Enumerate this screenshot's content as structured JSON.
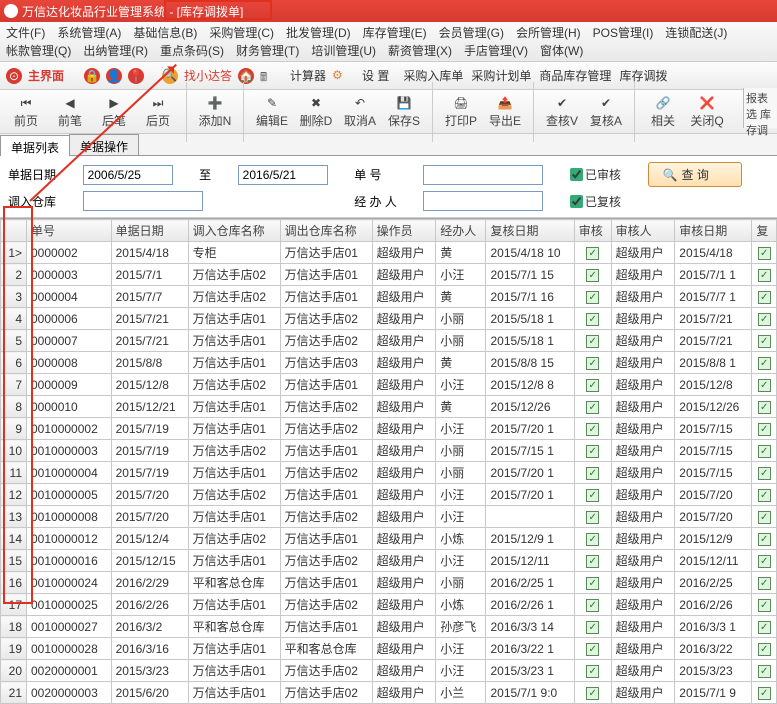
{
  "title": "万信达化妆品行业管理系统 - [库存调拨单]",
  "menu": [
    "文件(F)",
    "系统管理(A)",
    "基础信息(B)",
    "采购管理(C)",
    "批发管理(D)",
    "库存管理(E)",
    "会员管理(G)",
    "会所管理(H)",
    "POS管理(I)",
    "连锁配送(J)",
    "帐款管理(Q)",
    "出纳管理(R)",
    "重点条码(S)",
    "财务管理(T)",
    "培训管理(U)",
    "薪资管理(X)",
    "手店管理(V)",
    "窗体(W)"
  ],
  "tb1": {
    "main": "主界面",
    "find": "找小达答",
    "calc": "计算器",
    "setting": "设 置",
    "links": [
      "采购入库单",
      "采购计划单",
      "商品库存管理",
      "库存调拨"
    ]
  },
  "tb2": [
    "前页",
    "前笔",
    "后笔",
    "后页",
    "添加N",
    "编辑E",
    "删除D",
    "取消A",
    "保存S",
    "打印P",
    "导出E",
    "查核V",
    "复核A",
    "相关",
    "关闭Q"
  ],
  "side": "报表选\n库存调",
  "tabs": [
    "单据列表",
    "单据操作"
  ],
  "filter": {
    "dateLabel": "单据日期",
    "dateFrom": "2006/5/25",
    "to": "至",
    "dateTo": "2016/5/21",
    "codeLabel": "单   号",
    "handlerLabel": "经 办 人",
    "whLabel": "调入仓库",
    "chk1": "已审核",
    "chk2": "已复核",
    "query": "查 询"
  },
  "cols": [
    "",
    "单号",
    "单据日期",
    "调入仓库名称",
    "调出仓库名称",
    "操作员",
    "经办人",
    "复核日期",
    "审核",
    "审核人",
    "审核日期",
    "复"
  ],
  "rows": [
    [
      "1>",
      "0000002",
      "2015/4/18",
      "专柜",
      "万信达手店01",
      "超级用户",
      "黄",
      "2015/4/18 10",
      "✓",
      "超级用户",
      "2015/4/18",
      "✓"
    ],
    [
      "2",
      "0000003",
      "2015/7/1",
      "万信达手店02",
      "万信达手店01",
      "超级用户",
      "小汪",
      "2015/7/1 15",
      "✓",
      "超级用户",
      "2015/7/1 1",
      "✓"
    ],
    [
      "3",
      "0000004",
      "2015/7/7",
      "万信达手店02",
      "万信达手店01",
      "超级用户",
      "黄",
      "2015/7/1 16",
      "✓",
      "超级用户",
      "2015/7/7 1",
      "✓"
    ],
    [
      "4",
      "0000006",
      "2015/7/21",
      "万信达手店01",
      "万信达手店02",
      "超级用户",
      "小丽",
      "2015/5/18 1",
      "✓",
      "超级用户",
      "2015/7/21",
      "✓"
    ],
    [
      "5",
      "0000007",
      "2015/7/21",
      "万信达手店01",
      "万信达手店02",
      "超级用户",
      "小丽",
      "2015/5/18 1",
      "✓",
      "超级用户",
      "2015/7/21",
      "✓"
    ],
    [
      "6",
      "0000008",
      "2015/8/8",
      "万信达手店01",
      "万信达手店03",
      "超级用户",
      "黄",
      "2015/8/8 15",
      "✓",
      "超级用户",
      "2015/8/8 1",
      "✓"
    ],
    [
      "7",
      "0000009",
      "2015/12/8",
      "万信达手店02",
      "万信达手店01",
      "超级用户",
      "小汪",
      "2015/12/8 8",
      "✓",
      "超级用户",
      "2015/12/8",
      "✓"
    ],
    [
      "8",
      "0000010",
      "2015/12/21",
      "万信达手店01",
      "万信达手店02",
      "超级用户",
      "黄",
      "2015/12/26",
      "✓",
      "超级用户",
      "2015/12/26",
      "✓"
    ],
    [
      "9",
      "0010000002",
      "2015/7/19",
      "万信达手店01",
      "万信达手店02",
      "超级用户",
      "小汪",
      "2015/7/20 1",
      "✓",
      "超级用户",
      "2015/7/15",
      "✓"
    ],
    [
      "10",
      "0010000003",
      "2015/7/19",
      "万信达手店02",
      "万信达手店01",
      "超级用户",
      "小丽",
      "2015/7/15 1",
      "✓",
      "超级用户",
      "2015/7/15",
      "✓"
    ],
    [
      "11",
      "0010000004",
      "2015/7/19",
      "万信达手店01",
      "万信达手店02",
      "超级用户",
      "小丽",
      "2015/7/20 1",
      "✓",
      "超级用户",
      "2015/7/15",
      "✓"
    ],
    [
      "12",
      "0010000005",
      "2015/7/20",
      "万信达手店02",
      "万信达手店01",
      "超级用户",
      "小汪",
      "2015/7/20 1",
      "✓",
      "超级用户",
      "2015/7/20",
      "✓"
    ],
    [
      "13",
      "0010000008",
      "2015/7/20",
      "万信达手店01",
      "万信达手店02",
      "超级用户",
      "小汪",
      "",
      "✓",
      "超级用户",
      "2015/7/20",
      "✓"
    ],
    [
      "14",
      "0010000012",
      "2015/12/4",
      "万信达手店02",
      "万信达手店01",
      "超级用户",
      "小炼",
      "2015/12/9 1",
      "✓",
      "超级用户",
      "2015/12/9",
      "✓"
    ],
    [
      "15",
      "0010000016",
      "2015/12/15",
      "万信达手店01",
      "万信达手店02",
      "超级用户",
      "小汪",
      "2015/12/11",
      "✓",
      "超级用户",
      "2015/12/11",
      "✓"
    ],
    [
      "16",
      "0010000024",
      "2016/2/29",
      "平和客总仓库",
      "万信达手店01",
      "超级用户",
      "小丽",
      "2016/2/25 1",
      "✓",
      "超级用户",
      "2016/2/25",
      "✓"
    ],
    [
      "17",
      "0010000025",
      "2016/2/26",
      "万信达手店01",
      "万信达手店02",
      "超级用户",
      "小炼",
      "2016/2/26 1",
      "✓",
      "超级用户",
      "2016/2/26",
      "✓"
    ],
    [
      "18",
      "0010000027",
      "2016/3/2",
      "平和客总仓库",
      "万信达手店01",
      "超级用户",
      "孙彦飞",
      "2016/3/3 14",
      "✓",
      "超级用户",
      "2016/3/3 1",
      "✓"
    ],
    [
      "19",
      "0010000028",
      "2016/3/16",
      "万信达手店01",
      "平和客总仓库",
      "超级用户",
      "小汪",
      "2016/3/22 1",
      "✓",
      "超级用户",
      "2016/3/22",
      "✓"
    ],
    [
      "20",
      "0020000001",
      "2015/3/23",
      "万信达手店01",
      "万信达手店02",
      "超级用户",
      "小汪",
      "2015/3/23 1",
      "✓",
      "超级用户",
      "2015/3/23",
      "✓"
    ],
    [
      "21",
      "0020000003",
      "2015/6/20",
      "万信达手店01",
      "万信达手店02",
      "超级用户",
      "小兰",
      "2015/7/1 9:0",
      "✓",
      "超级用户",
      "2015/7/1 9",
      "✓"
    ]
  ]
}
